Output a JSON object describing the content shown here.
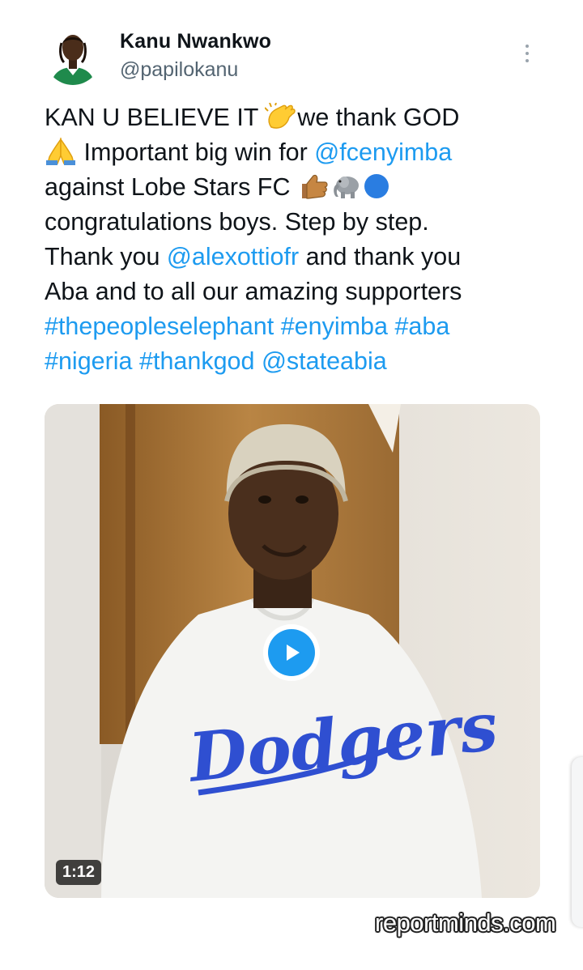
{
  "author": {
    "display_name": "Kanu Nwankwo",
    "handle": "@papilokanu",
    "avatar_icon": "profile-photo"
  },
  "menu": {
    "icon": "more-vertical-icon"
  },
  "tweet": {
    "lines": [
      [
        {
          "t": "KAN U BELIEVE IT "
        },
        {
          "emoji": "clapping-hands"
        },
        {
          "t": "we thank GOD"
        }
      ],
      [
        {
          "emoji": "folded-hands"
        },
        {
          "t": " Important big win for "
        },
        {
          "link": "@fcenyimba"
        }
      ],
      [
        {
          "t": "against Lobe Stars FC "
        },
        {
          "emoji": "thumbs-up"
        },
        {
          "emoji": "elephant"
        },
        {
          "emoji": "blue-circle"
        }
      ],
      [
        {
          "t": "congratulations boys. Step by step."
        }
      ],
      [
        {
          "t": "Thank you "
        },
        {
          "link": "@alexottiofr"
        },
        {
          "t": " and thank you"
        }
      ],
      [
        {
          "t": "Aba and to all our amazing supporters"
        }
      ],
      [
        {
          "link": "#thepeopleselephant"
        },
        {
          "t": " "
        },
        {
          "link": "#enyimba"
        },
        {
          "t": " "
        },
        {
          "link": "#aba"
        }
      ],
      [
        {
          "link": "#nigeria"
        },
        {
          "t": " "
        },
        {
          "link": "#thankgod"
        },
        {
          "t": " "
        },
        {
          "link": "@stateabia"
        }
      ]
    ]
  },
  "media": {
    "jersey_text": "Dodgers",
    "duration": "1:12",
    "play_icon": "play-icon"
  },
  "watermark": "reportminds.com",
  "colors": {
    "link": "#1d9bf0",
    "text": "#0f1419",
    "secondary": "#536471"
  }
}
